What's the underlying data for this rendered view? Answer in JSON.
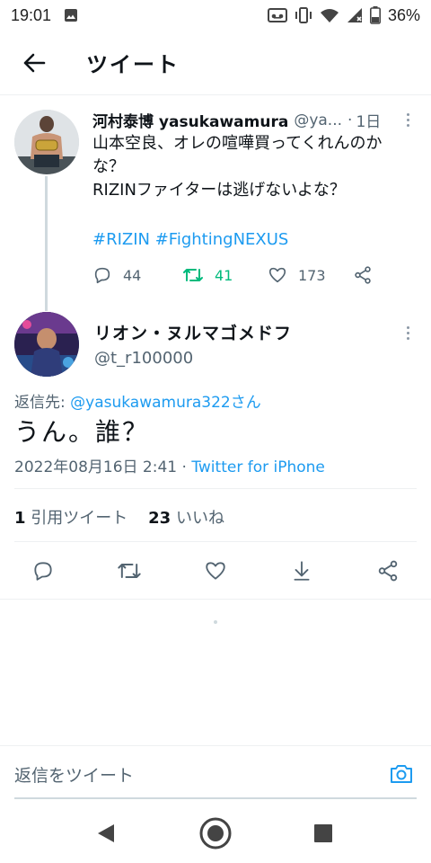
{
  "status_bar": {
    "time": "19:01",
    "battery": "36%",
    "icons": [
      "image-icon",
      "voicemail-icon",
      "vibrate-icon",
      "wifi-icon",
      "signal-icon",
      "battery-icon"
    ]
  },
  "header": {
    "title": "ツイート",
    "back_icon": "arrow-left-icon"
  },
  "parent_tweet": {
    "name": "河村泰博 yasukawamura",
    "handle": "@ya...",
    "time": "1日",
    "text_lines": [
      "山本空良、オレの喧嘩買ってくれんのか",
      "な？",
      "RIZINファイターは逃げないよな？"
    ],
    "hashtags": "#RIZIN #FightingNEXUS",
    "reply_count": "44",
    "retweet_count": "41",
    "like_count": "173"
  },
  "main_tweet": {
    "name": "リオン・ヌルマゴメドフ",
    "handle": "@t_r100000",
    "replying_label": "返信先: ",
    "replying_to": "@yasukawamura322さん",
    "text": "うん。誰？",
    "date": "2022年08月16日 2:41 · ",
    "source": "Twitter for iPhone",
    "quote_count": "1",
    "quote_label": "引用ツイート",
    "like_count": "23",
    "like_label": "いいね"
  },
  "reply_box": {
    "placeholder": "返信をツイート",
    "camera_icon": "camera-icon"
  },
  "colors": {
    "accent": "#1d9bf0",
    "retweet_green": "#00ba7c",
    "muted": "#536471",
    "text": "#0f1419"
  }
}
